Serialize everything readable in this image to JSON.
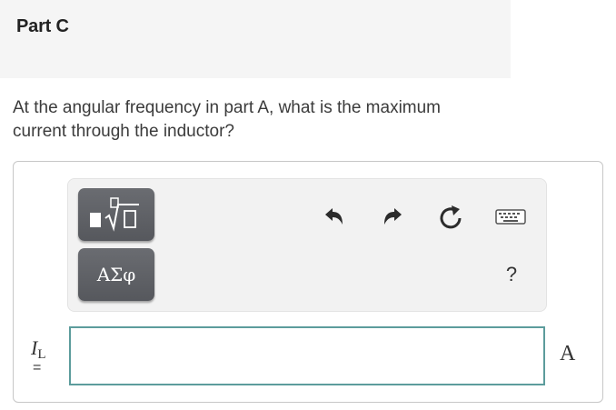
{
  "part": {
    "title": "Part C"
  },
  "question": {
    "text": "At the angular frequency in part A, what is the maximum current through the inductor?"
  },
  "toolbar": {
    "templates_icon": "templates-icon",
    "symbols_label": "ΑΣφ",
    "undo_icon": "undo-icon",
    "redo_icon": "redo-icon",
    "reset_icon": "reset-icon",
    "keyboard_icon": "keyboard-icon",
    "help_label": "?"
  },
  "answer": {
    "variable_symbol": "I",
    "variable_subscript": "L",
    "equals": "=",
    "value": "",
    "unit": "A"
  },
  "colors": {
    "header_bg": "#f5f5f5",
    "toolbar_bg": "#f2f2f2",
    "button_bg": "#5f6166",
    "input_border": "#5c9c9c"
  }
}
